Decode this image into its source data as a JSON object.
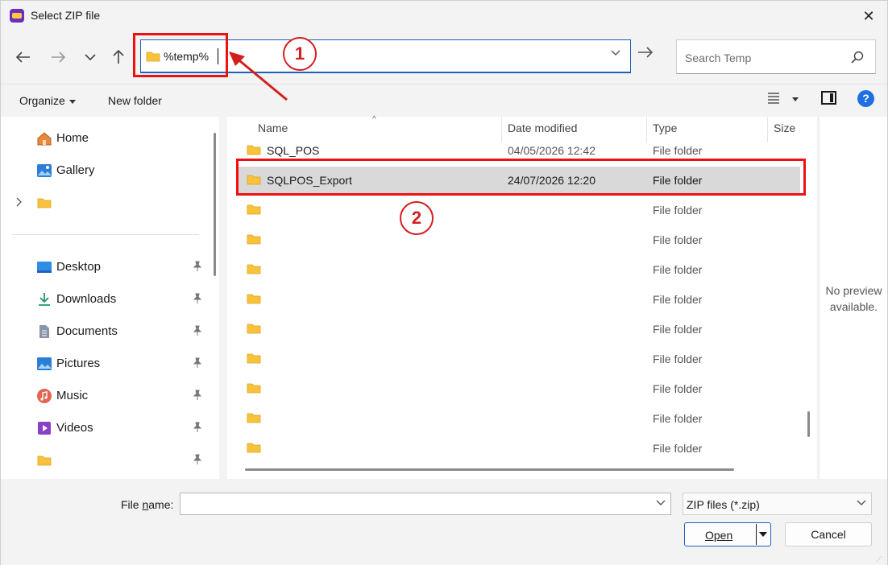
{
  "window": {
    "title": "Select ZIP file"
  },
  "address": {
    "path": "%temp%"
  },
  "search": {
    "placeholder": "Search Temp"
  },
  "toolbar": {
    "organize": "Organize",
    "new_folder": "New folder",
    "help": "?"
  },
  "nav": {
    "items": [
      {
        "label": "Home",
        "icon": "home-icon"
      },
      {
        "label": "Gallery",
        "icon": "gallery-icon"
      },
      {
        "label": "",
        "icon": "folder-icon",
        "expandable": true
      },
      {
        "label": "Desktop",
        "icon": "desktop-icon",
        "pinned": true
      },
      {
        "label": "Downloads",
        "icon": "download-icon",
        "pinned": true
      },
      {
        "label": "Documents",
        "icon": "documents-icon",
        "pinned": true
      },
      {
        "label": "Pictures",
        "icon": "pictures-icon",
        "pinned": true
      },
      {
        "label": "Music",
        "icon": "music-icon",
        "pinned": true
      },
      {
        "label": "Videos",
        "icon": "videos-icon",
        "pinned": true
      },
      {
        "label": "",
        "icon": "folder-icon",
        "pinned": true
      }
    ]
  },
  "files": {
    "columns": [
      "Name",
      "Date modified",
      "Type",
      "Size"
    ],
    "rows": [
      {
        "name": "SQL_POS",
        "date": "04/05/2026 12:42",
        "type": "File folder"
      },
      {
        "name": "SQLPOS_Export",
        "date": "24/07/2026 12:20",
        "type": "File folder",
        "selected": true
      },
      {
        "name": "",
        "date": "",
        "type": "File folder"
      },
      {
        "name": "",
        "date": "",
        "type": "File folder"
      },
      {
        "name": "",
        "date": "",
        "type": "File folder"
      },
      {
        "name": "",
        "date": "",
        "type": "File folder"
      },
      {
        "name": "",
        "date": "",
        "type": "File folder"
      },
      {
        "name": "",
        "date": "",
        "type": "File folder"
      },
      {
        "name": "",
        "date": "",
        "type": "File folder"
      },
      {
        "name": "",
        "date": "",
        "type": "File folder"
      },
      {
        "name": "",
        "date": "",
        "type": "File folder"
      }
    ]
  },
  "preview": {
    "line1": "No preview",
    "line2": "available."
  },
  "footer": {
    "file_name_label_pre": "File ",
    "file_name_label_ul": "n",
    "file_name_label_post": "ame:",
    "file_name_value": "",
    "file_type": "ZIP files (*.zip)",
    "open_label": "Open",
    "cancel_label": "Cancel"
  },
  "annotations": {
    "step1": "1",
    "step2": "2"
  },
  "colors": {
    "highlight": "#e11111",
    "accent": "#1f5fbf",
    "folder": "#f8c33a"
  }
}
